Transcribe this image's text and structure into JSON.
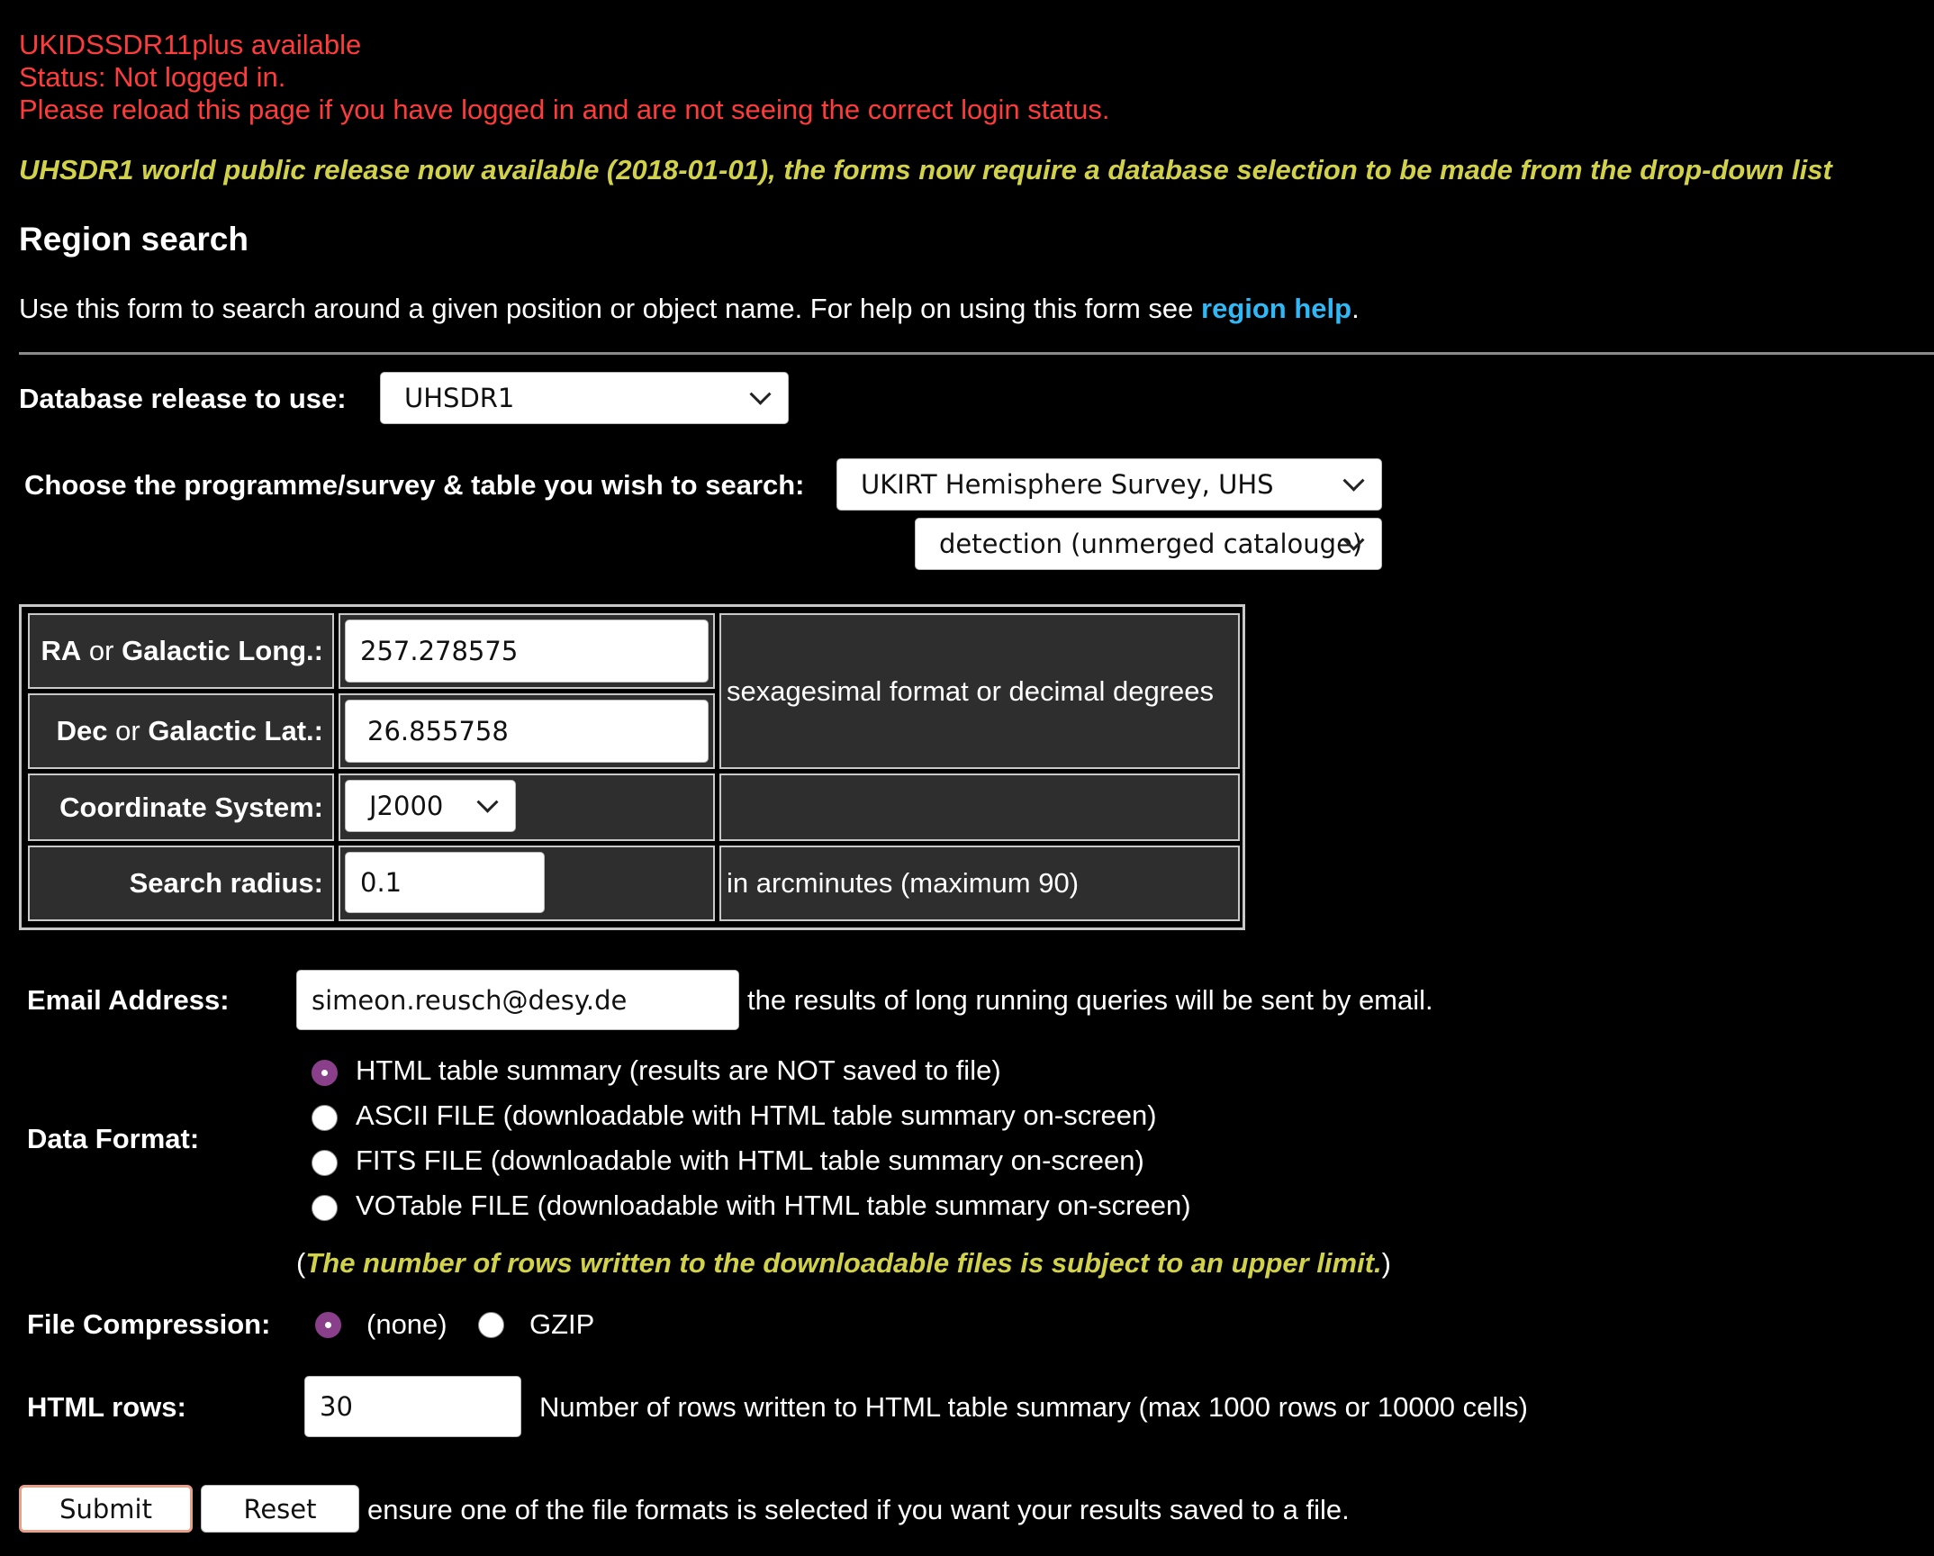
{
  "status": {
    "line1": "UKIDSSDR11plus available",
    "line2": "Status: Not logged in.",
    "line3": "Please reload this page if you have logged in and are not seeing the correct login status."
  },
  "notice": "UHSDR1 world public release now available (2018-01-01), the forms now require a database selection to be made from the drop-down list",
  "page_title": "Region search",
  "intro": {
    "text": "Use this form to search around a given position or object name. For help on using this form see ",
    "link": "region help",
    "end": "."
  },
  "database": {
    "label": "Database release to use:",
    "value": "UHSDR1"
  },
  "programme": {
    "label": "Choose the programme/survey & table you wish to search:",
    "survey": "UKIRT Hemisphere Survey, UHS",
    "table": "detection (unmerged catalouge)"
  },
  "coords": {
    "ra_a": "RA",
    "ra_or": " or ",
    "ra_b": "Galactic Long.:",
    "ra_value": "257.278575",
    "dec_a": "Dec",
    "dec_or": " or ",
    "dec_b": "Galactic Lat.:",
    "dec_value": "26.855758",
    "format_note": "sexagesimal format or decimal degrees",
    "system_label": "Coordinate System:",
    "system_value": "J2000",
    "radius_label": "Search radius:",
    "radius_value": "0.1",
    "radius_note": "in arcminutes (maximum 90)"
  },
  "email": {
    "label": "Email Address:",
    "value": "simeon.reusch@desy.de",
    "note": "the results of long running queries will be sent by email."
  },
  "data_format": {
    "label": "Data Format:",
    "options": [
      "HTML table summary (results are NOT saved to file)",
      "ASCII FILE (downloadable with HTML table summary on-screen)",
      "FITS FILE (downloadable with HTML table summary on-screen)",
      "VOTable FILE (downloadable with HTML table summary on-screen)"
    ],
    "selected_index": 0,
    "limit_open": "(",
    "limit_note": "The number of rows written to the downloadable files is subject to an upper limit.",
    "limit_close": ")"
  },
  "compression": {
    "label": "File Compression:",
    "options": [
      "(none)",
      "GZIP"
    ],
    "selected_index": 0
  },
  "html_rows": {
    "label": "HTML rows:",
    "value": "30",
    "note": "Number of rows written to HTML table summary (max 1000 rows or 10000 cells)"
  },
  "buttons": {
    "submit": "Submit",
    "reset": "Reset",
    "note": "ensure one of the file formats is selected if you want your results saved to a file."
  },
  "colors": {
    "status_red": "#ff3b3b",
    "notice_yellow": "#d2d24a",
    "link_blue": "#2fb8f5",
    "radio_selected": "#8a3f8a"
  }
}
